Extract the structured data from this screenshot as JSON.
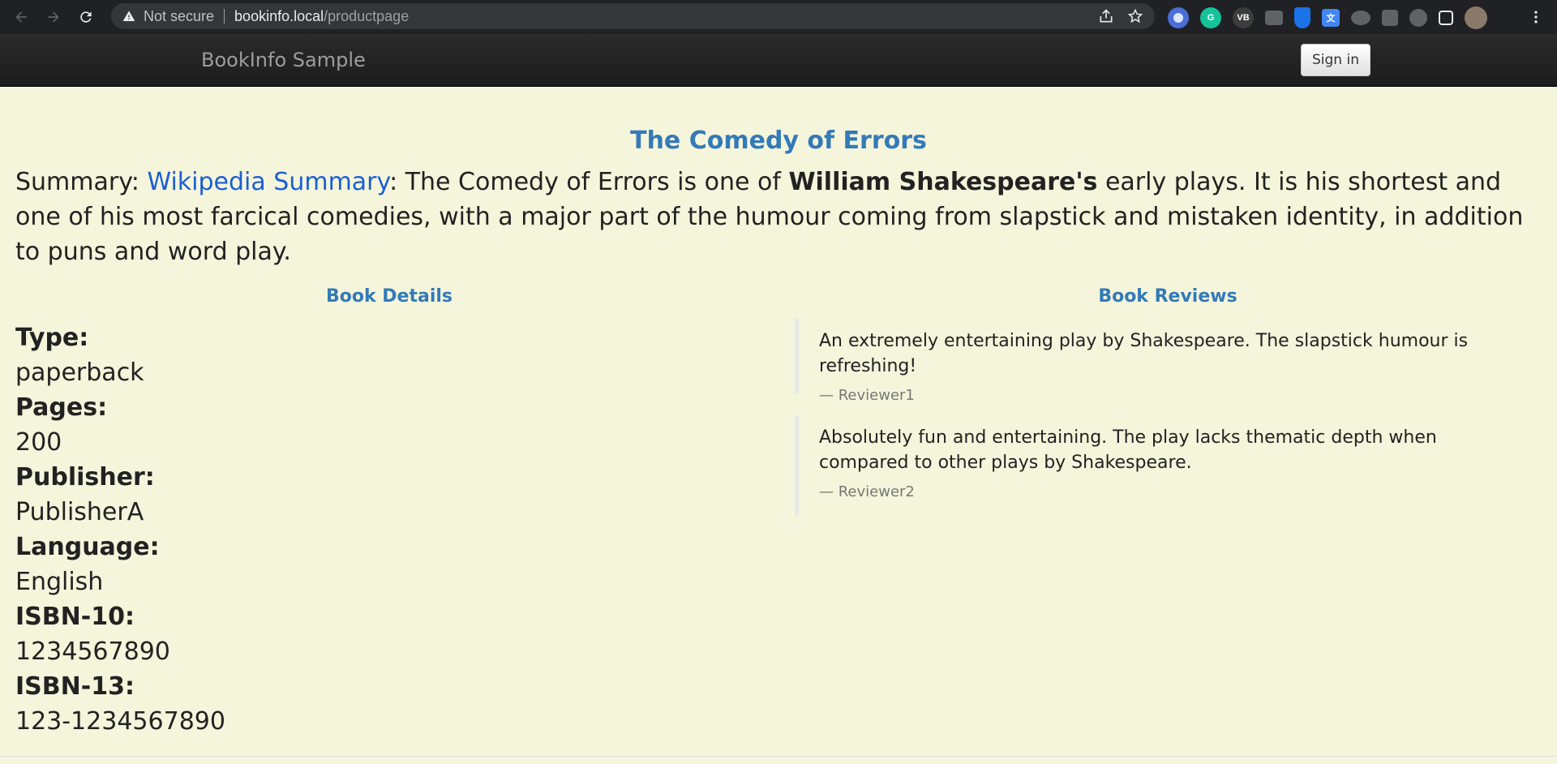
{
  "browser": {
    "security_label": "Not secure",
    "url_host": "bookinfo.local",
    "url_path": "/productpage",
    "extensions": [
      {
        "name": "ext-blue-circle",
        "label": "",
        "color": "#7aa7ff"
      },
      {
        "name": "grammarly",
        "label": "G",
        "color": "#15c39a"
      },
      {
        "name": "vb",
        "label": "VB",
        "color": "#3c3c3c"
      },
      {
        "name": "camera",
        "label": "",
        "color": "#5f6368"
      },
      {
        "name": "shield",
        "label": "",
        "color": "#1a73e8"
      },
      {
        "name": "translate",
        "label": "",
        "color": "#4285f4"
      },
      {
        "name": "cloud",
        "label": "",
        "color": "#5f6368"
      },
      {
        "name": "puzzle",
        "label": "",
        "color": "#5f6368"
      },
      {
        "name": "bolt",
        "label": "",
        "color": "#5f6368"
      },
      {
        "name": "sidepanel",
        "label": "",
        "color": "#5f6368"
      }
    ]
  },
  "navbar": {
    "brand": "BookInfo Sample",
    "signin_label": "Sign in"
  },
  "book": {
    "title": "The Comedy of Errors",
    "summary_prefix": "Summary: ",
    "summary_link": "Wikipedia Summary",
    "summary_part1": ": The Comedy of Errors is one of ",
    "summary_bold": "William Shakespeare's",
    "summary_part2": " early plays. It is his shortest and one of his most farcical comedies, with a major part of the humour coming from slapstick and mistaken identity, in addition to puns and word play."
  },
  "details": {
    "heading": "Book Details",
    "items": [
      {
        "label": "Type:",
        "value": "paperback"
      },
      {
        "label": "Pages:",
        "value": "200"
      },
      {
        "label": "Publisher:",
        "value": "PublisherA"
      },
      {
        "label": "Language:",
        "value": "English"
      },
      {
        "label": "ISBN-10:",
        "value": "1234567890"
      },
      {
        "label": "ISBN-13:",
        "value": "123-1234567890"
      }
    ]
  },
  "reviews": {
    "heading": "Book Reviews",
    "items": [
      {
        "text": "An extremely entertaining play by Shakespeare. The slapstick humour is refreshing!",
        "author": "— Reviewer1"
      },
      {
        "text": "Absolutely fun and entertaining. The play lacks thematic depth when compared to other plays by Shakespeare.",
        "author": "— Reviewer2"
      }
    ]
  }
}
